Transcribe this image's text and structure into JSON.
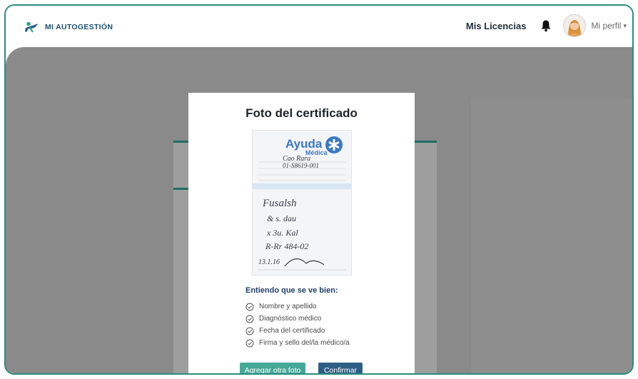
{
  "header": {
    "brand": "MI AUTOGESTIÓN",
    "nav_link": "Mis Licencias",
    "profile_label": "Mi perfil",
    "caret": "▾"
  },
  "modal": {
    "title": "Foto del certificado",
    "certificate": {
      "logo_top": "Ayuda",
      "logo_bottom": "Médica",
      "handwriting": [
        "Cao Rara",
        "01-S8619-001",
        "Fusalsh",
        "& s. dau",
        "x 3u. Kal",
        "R-Rr 484-02",
        "13.1.16"
      ]
    },
    "checklist_title": "Entiendo que se ve bien:",
    "checklist": [
      "Nombre y apellido",
      "Diagnóstico médico",
      "Fecha del certificado",
      "Firma y sello del/la médico/a"
    ],
    "buttons": {
      "add_photo": "Agregar otra foto",
      "confirm": "Confirmar"
    }
  },
  "colors": {
    "frame": "#2c8c7c",
    "brand_text": "#1d4f6e",
    "overlay": "#8a8a8a",
    "add_button": "#46a996",
    "confirm_button": "#2d5f86",
    "checklist_title": "#1f3f68"
  },
  "icons": {
    "brand": "person-running-icon",
    "bell": "bell-icon",
    "avatar": "user-avatar",
    "check": "check-circle-icon"
  }
}
